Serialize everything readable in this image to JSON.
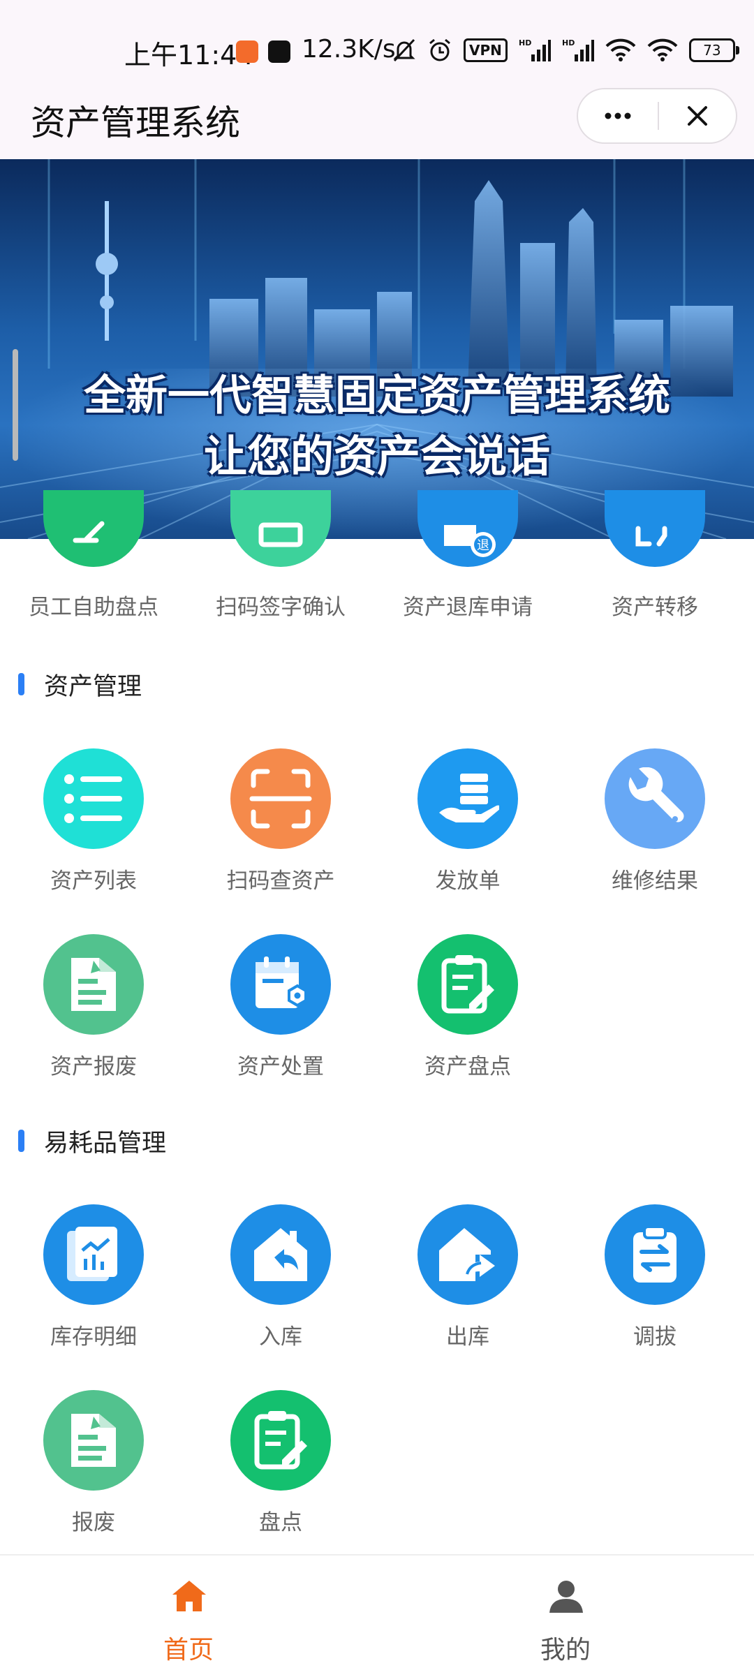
{
  "status_bar": {
    "time": "上午11:44",
    "net_speed": "12.3K/s",
    "vpn": "VPN",
    "battery": "73"
  },
  "header": {
    "title": "资产管理系统"
  },
  "banner": {
    "line1": "全新一代智慧固定资产管理系统",
    "line2": "让您的资产会说话"
  },
  "top_row": [
    {
      "label": "员工自助盘点",
      "color": "#1fbf73",
      "icon": "edit-icon"
    },
    {
      "label": "扫码签字确认",
      "color": "#3dd29b",
      "icon": "scan-sign-icon"
    },
    {
      "label": "资产退库申请",
      "color": "#1e8ee6",
      "icon": "return-icon"
    },
    {
      "label": "资产转移",
      "color": "#1e8ee6",
      "icon": "transfer-icon"
    }
  ],
  "sections": [
    {
      "title": "资产管理",
      "items": [
        {
          "label": "资产列表",
          "color": "#1fe0d6",
          "icon": "list-icon"
        },
        {
          "label": "扫码查资产",
          "color": "#f58a4b",
          "icon": "scan-icon"
        },
        {
          "label": "发放单",
          "color": "#1e9af0",
          "icon": "hand-distribute-icon"
        },
        {
          "label": "维修结果",
          "color": "#67a8f5",
          "icon": "wrench-icon"
        },
        {
          "label": "资产报废",
          "color": "#52c28e",
          "icon": "scrap-doc-icon"
        },
        {
          "label": "资产处置",
          "color": "#1e8ee6",
          "icon": "calendar-gear-icon"
        },
        {
          "label": "资产盘点",
          "color": "#14c06f",
          "icon": "clipboard-edit-icon"
        }
      ]
    },
    {
      "title": "易耗品管理",
      "items": [
        {
          "label": "库存明细",
          "color": "#1e8ee6",
          "icon": "inventory-chart-icon"
        },
        {
          "label": "入库",
          "color": "#1e8ee6",
          "icon": "stock-in-icon"
        },
        {
          "label": "出库",
          "color": "#1e8ee6",
          "icon": "stock-out-icon"
        },
        {
          "label": "调拔",
          "color": "#1e8ee6",
          "icon": "clipboard-swap-icon"
        },
        {
          "label": "报废",
          "color": "#52c28e",
          "icon": "scrap-doc-icon"
        },
        {
          "label": "盘点",
          "color": "#14c06f",
          "icon": "clipboard-edit-icon"
        }
      ]
    }
  ],
  "tabbar": [
    {
      "label": "首页",
      "active": true,
      "color": "#f06a1a",
      "icon": "home-icon"
    },
    {
      "label": "我的",
      "active": false,
      "color": "#555555",
      "icon": "person-icon"
    }
  ]
}
